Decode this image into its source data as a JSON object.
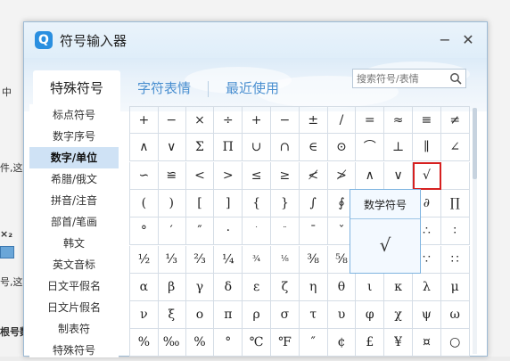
{
  "background": {
    "fragments": [
      "中",
      "件,这",
      "×₂",
      "号,这",
      "根号数"
    ]
  },
  "dialog": {
    "logo": "Q",
    "title": "符号输入器",
    "min_label": "−",
    "close_label": "✕"
  },
  "tabs": [
    {
      "label": "特殊符号",
      "active": true
    },
    {
      "label": "字符表情",
      "active": false
    },
    {
      "label": "最近使用",
      "active": false
    }
  ],
  "search": {
    "placeholder": "搜索符号/表情",
    "icon": "search-icon"
  },
  "sidebar": {
    "items": [
      "标点符号",
      "数字序号",
      "数字/单位",
      "希腊/俄文",
      "拼音/注音",
      "部首/笔画",
      "韩文",
      "英文音标",
      "日文平假名",
      "日文片假名",
      "制表符",
      "特殊符号"
    ],
    "active_index": 2
  },
  "grid": {
    "rows": [
      [
        "+",
        "−",
        "×",
        "÷",
        "+",
        "−",
        "±",
        "/",
        "=",
        "≈",
        "≡",
        "≠"
      ],
      [
        "∧",
        "∨",
        "Σ",
        "Π",
        "∪",
        "∩",
        "∈",
        "⊙",
        "⌒",
        "⊥",
        "∥",
        "∠"
      ],
      [
        "∽",
        "≌",
        "<",
        ">",
        "≤",
        "≥",
        "≮",
        "≯",
        "∧",
        "∨",
        "√",
        ""
      ],
      [
        "(",
        ")",
        "[",
        "]",
        "{",
        "}",
        "∫",
        "∮",
        "",
        "",
        "∂",
        "∏"
      ],
      [
        "°",
        "′",
        "″",
        "·",
        "˙",
        "¨",
        "ˉ",
        "ˇ",
        "",
        "",
        "∴",
        "∶"
      ],
      [
        "½",
        "⅓",
        "⅔",
        "¼",
        "¾",
        "⅛",
        "⅜",
        "⅝",
        "",
        "",
        "∵",
        "∷"
      ],
      [
        "α",
        "β",
        "γ",
        "δ",
        "ε",
        "ζ",
        "η",
        "θ",
        "ι",
        "κ",
        "λ",
        "μ"
      ],
      [
        "ν",
        "ξ",
        "ο",
        "π",
        "ρ",
        "σ",
        "τ",
        "υ",
        "φ",
        "χ",
        "ψ",
        "ω"
      ],
      [
        "%",
        "‰",
        "%",
        "°",
        "℃",
        "℉",
        "″",
        "¢",
        "£",
        "¥",
        "¤",
        "○"
      ]
    ],
    "small_cols": [
      4,
      5
    ],
    "selected": {
      "row": 2,
      "col": 10
    }
  },
  "tooltip": {
    "title": "数学符号",
    "symbol": "√"
  }
}
